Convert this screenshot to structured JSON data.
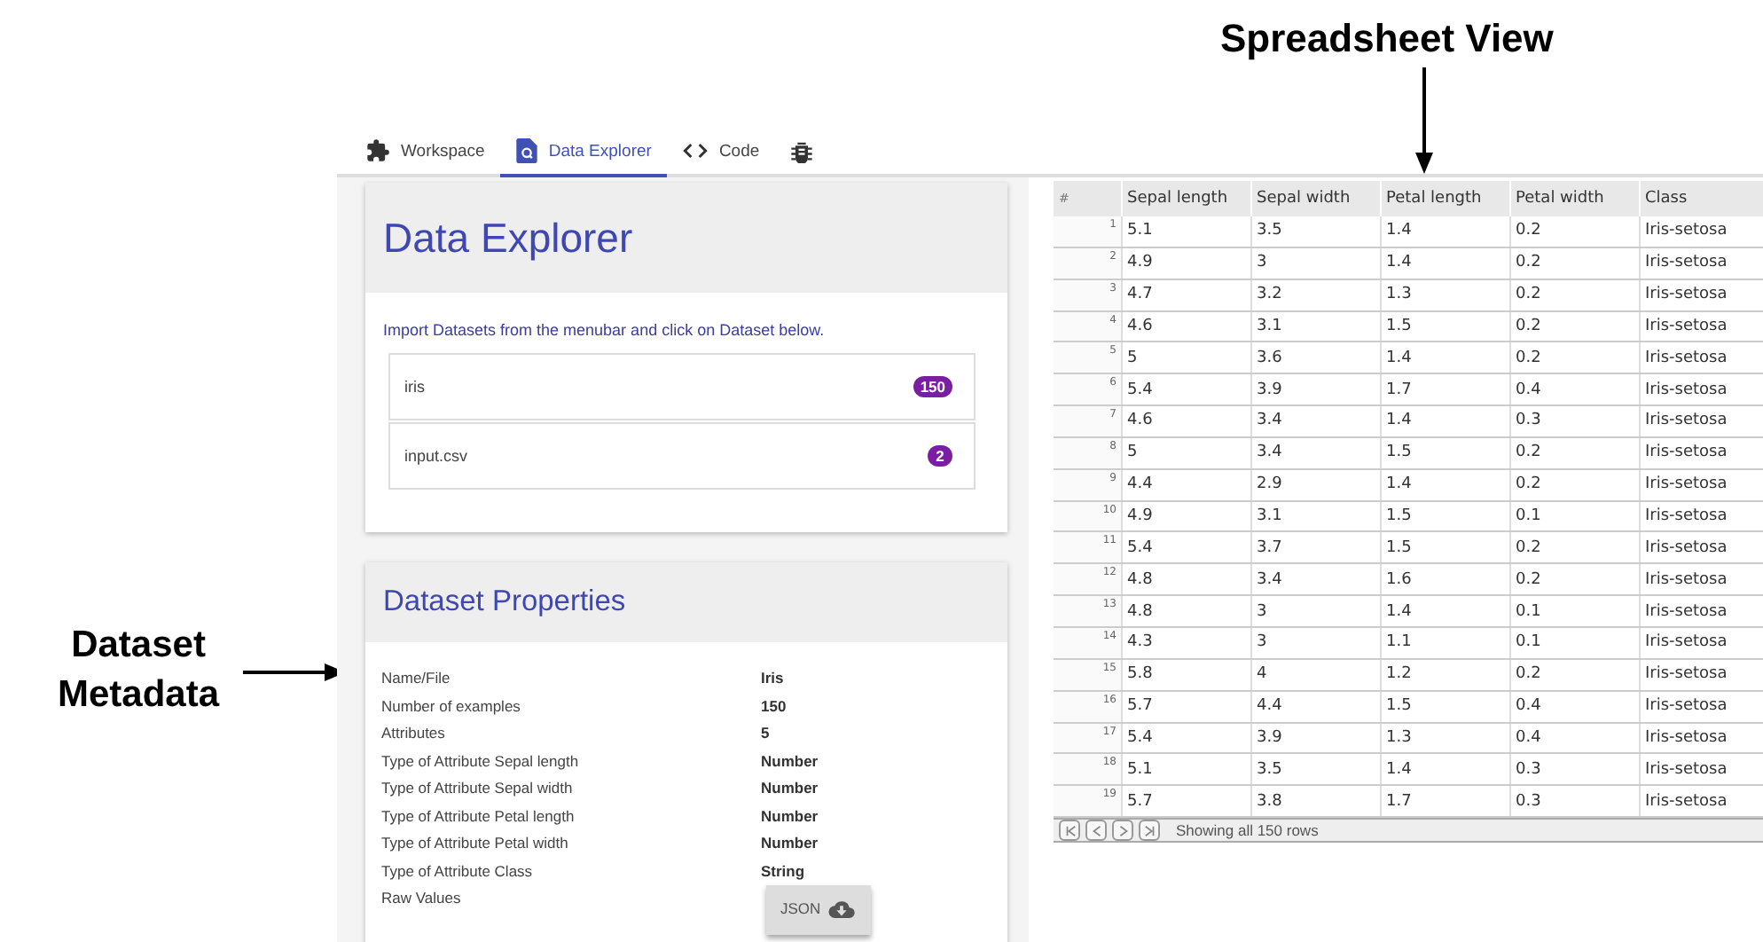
{
  "annotations": [
    {
      "kind": "down",
      "text": "Spreadsheet View"
    },
    {
      "kind": "right",
      "text": "Dataset Metadata"
    }
  ],
  "tabs": [
    {
      "kind": "puzzle",
      "label": "Workspace",
      "selected": false
    },
    {
      "kind": "explorer",
      "label": "Data Explorer",
      "selected": true
    },
    {
      "kind": "code",
      "label": "Code",
      "selected": false
    },
    {
      "kind": "bug",
      "selected": false
    }
  ],
  "explorer": {
    "title": "Data Explorer",
    "hint": "Import Datasets from the menubar and click on Dataset below.",
    "datasets": [
      {
        "name": "iris",
        "count": "150"
      },
      {
        "name": "input.csv",
        "count": "2"
      }
    ]
  },
  "properties": {
    "title": "Dataset Properties",
    "rows": [
      {
        "label": "Name/File",
        "value": "Iris"
      },
      {
        "label": "Number of examples",
        "value": "150"
      },
      {
        "label": "Attributes",
        "value": "5"
      },
      {
        "label": "Type of Attribute Sepal length",
        "value": "Number"
      },
      {
        "label": "Type of Attribute Sepal width",
        "value": "Number"
      },
      {
        "label": "Type of Attribute Petal length",
        "value": "Number"
      },
      {
        "label": "Type of Attribute Petal width",
        "value": "Number"
      },
      {
        "label": "Type of Attribute Class",
        "value": "String"
      }
    ],
    "raw_label": "Raw Values",
    "button": "JSON"
  },
  "sheet": {
    "columns": [
      "#",
      "Sepal length",
      "Sepal width",
      "Petal length",
      "Petal width",
      "Class"
    ],
    "rows": [
      [
        "1",
        "5.1",
        "3.5",
        "1.4",
        "0.2",
        "Iris-setosa"
      ],
      [
        "2",
        "4.9",
        "3",
        "1.4",
        "0.2",
        "Iris-setosa"
      ],
      [
        "3",
        "4.7",
        "3.2",
        "1.3",
        "0.2",
        "Iris-setosa"
      ],
      [
        "4",
        "4.6",
        "3.1",
        "1.5",
        "0.2",
        "Iris-setosa"
      ],
      [
        "5",
        "5",
        "3.6",
        "1.4",
        "0.2",
        "Iris-setosa"
      ],
      [
        "6",
        "5.4",
        "3.9",
        "1.7",
        "0.4",
        "Iris-setosa"
      ],
      [
        "7",
        "4.6",
        "3.4",
        "1.4",
        "0.3",
        "Iris-setosa"
      ],
      [
        "8",
        "5",
        "3.4",
        "1.5",
        "0.2",
        "Iris-setosa"
      ],
      [
        "9",
        "4.4",
        "2.9",
        "1.4",
        "0.2",
        "Iris-setosa"
      ],
      [
        "10",
        "4.9",
        "3.1",
        "1.5",
        "0.1",
        "Iris-setosa"
      ],
      [
        "11",
        "5.4",
        "3.7",
        "1.5",
        "0.2",
        "Iris-setosa"
      ],
      [
        "12",
        "4.8",
        "3.4",
        "1.6",
        "0.2",
        "Iris-setosa"
      ],
      [
        "13",
        "4.8",
        "3",
        "1.4",
        "0.1",
        "Iris-setosa"
      ],
      [
        "14",
        "4.3",
        "3",
        "1.1",
        "0.1",
        "Iris-setosa"
      ],
      [
        "15",
        "5.8",
        "4",
        "1.2",
        "0.2",
        "Iris-setosa"
      ],
      [
        "16",
        "5.7",
        "4.4",
        "1.5",
        "0.4",
        "Iris-setosa"
      ],
      [
        "17",
        "5.4",
        "3.9",
        "1.3",
        "0.4",
        "Iris-setosa"
      ],
      [
        "18",
        "5.1",
        "3.5",
        "1.4",
        "0.3",
        "Iris-setosa"
      ],
      [
        "19",
        "5.7",
        "3.8",
        "1.7",
        "0.3",
        "Iris-setosa"
      ]
    ],
    "status": "Showing all 150 rows"
  }
}
